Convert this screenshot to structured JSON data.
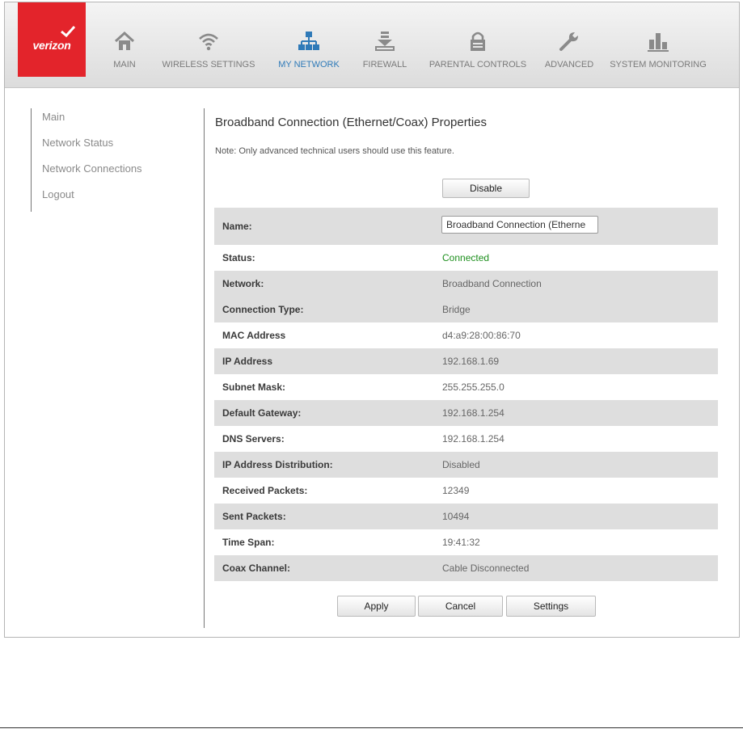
{
  "brand": {
    "logo_text": "verizon",
    "colors": {
      "logo_red": "#e3242b",
      "active_nav": "#2f7ab8",
      "status_ok": "#1d8f1d"
    }
  },
  "nav": {
    "items": [
      {
        "label": "MAIN",
        "icon": "home-icon"
      },
      {
        "label": "WIRELESS SETTINGS",
        "icon": "wifi-icon"
      },
      {
        "label": "MY NETWORK",
        "icon": "network-icon",
        "active": true
      },
      {
        "label": "FIREWALL",
        "icon": "firewall-icon"
      },
      {
        "label": "PARENTAL CONTROLS",
        "icon": "lock-icon"
      },
      {
        "label": "ADVANCED",
        "icon": "wrench-icon"
      },
      {
        "label": "SYSTEM MONITORING",
        "icon": "bar-chart-icon"
      }
    ]
  },
  "sidebar": {
    "items": [
      {
        "label": "Main"
      },
      {
        "label": "Network Status"
      },
      {
        "label": "Network Connections"
      },
      {
        "label": "Logout"
      }
    ]
  },
  "content": {
    "title": "Broadband Connection (Ethernet/Coax) Properties",
    "note": "Note: Only advanced technical users should use this feature.",
    "disable_label": "Disable",
    "name_label": "Name:",
    "name_value": "Broadband Connection (Etherne",
    "rows": [
      {
        "label": "Status:",
        "value": "Connected"
      },
      {
        "label": "Network:",
        "value": "Broadband Connection"
      },
      {
        "label": "Connection Type:",
        "value": "Bridge"
      },
      {
        "label": "MAC Address",
        "value": "d4:a9:28:00:86:70"
      },
      {
        "label": "IP Address",
        "value": "192.168.1.69"
      },
      {
        "label": "Subnet Mask:",
        "value": "255.255.255.0"
      },
      {
        "label": "Default Gateway:",
        "value": "192.168.1.254"
      },
      {
        "label": "DNS Servers:",
        "value": "192.168.1.254"
      },
      {
        "label": "IP Address Distribution:",
        "value": "Disabled"
      },
      {
        "label": "Received Packets:",
        "value": "12349"
      },
      {
        "label": "Sent Packets:",
        "value": "10494"
      },
      {
        "label": "Time Span:",
        "value": "19:41:32"
      },
      {
        "label": "Coax Channel:",
        "value": "Cable Disconnected"
      }
    ],
    "buttons": {
      "apply": "Apply",
      "cancel": "Cancel",
      "settings": "Settings"
    }
  }
}
